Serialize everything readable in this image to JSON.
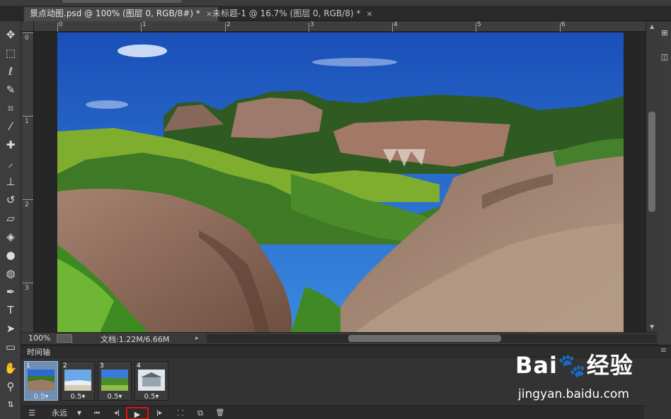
{
  "tabs": [
    {
      "label": "景点动图.psd @ 100% (图层 0, RGB/8#) *",
      "close": "×"
    },
    {
      "label": "未标题-1 @ 16.7% (图层 0, RGB/8) *",
      "close": "×"
    }
  ],
  "ruler": {
    "top_numbers": [
      "0",
      "1",
      "2",
      "3",
      "4",
      "5",
      "6"
    ],
    "left_numbers": [
      "0",
      "1",
      "2",
      "3"
    ]
  },
  "status": {
    "zoom": "100%",
    "doc": "文档:1.22M/6.66M",
    "arrow": "▸"
  },
  "timeline": {
    "title": "时间轴",
    "menu_icon": "≡",
    "frames": [
      {
        "number": "1",
        "delay": "0.5▾"
      },
      {
        "number": "2",
        "delay": "0.5▾"
      },
      {
        "number": "3",
        "delay": "0.5▾"
      },
      {
        "number": "4",
        "delay": "0.5▾"
      }
    ],
    "loop": "永远",
    "controls": {
      "first": "⏮",
      "prev": "◂ǀ",
      "play": "▶",
      "next": "ǀ▸",
      "tween": "⸬",
      "new_frame": "⧉",
      "delete": "🗑"
    }
  },
  "watermark": {
    "logo": "Bai🐾经验",
    "url": "jingyan.baidu.com"
  },
  "colors": {
    "sky": "#1f5fc8",
    "grass": "#7fae2f",
    "rock": "#9c7a63",
    "play_highlight": "#e01010"
  }
}
